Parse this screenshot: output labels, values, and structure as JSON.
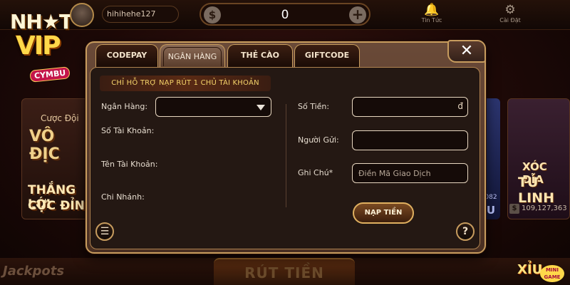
{
  "header": {
    "logo_line1": "NH★T",
    "logo_line2": "VIP",
    "logo_badge": "CYMBU",
    "username": "hihihehe127",
    "currency_symbol": "$",
    "balance": "0",
    "add_symbol": "+",
    "buttons": [
      {
        "icon": "bell-icon",
        "glyph": "🔔",
        "label": "Tin Tức"
      },
      {
        "icon": "gear-icon",
        "glyph": "⚙",
        "label": "Cài Đặt"
      }
    ]
  },
  "background": {
    "left_card": {
      "line1": "Cược Đội",
      "line2": "VÔ ĐỊC",
      "line3": "THẮNG LỚI",
      "line4": "CỰC ĐỈN"
    },
    "mid_strip": {
      "number": "082",
      "text": "U"
    },
    "right_card": {
      "line1": "XÓC ĐĨA",
      "line2": "TỨ LINH"
    },
    "jackpot_currency": "$",
    "jackpot_value": "109,127,363"
  },
  "footer": {
    "jackpots_label": "Jackpots",
    "center_button": "RÚT TIỀN",
    "xiu_label": "XỈU",
    "mini_game_label": "MINI GAME"
  },
  "modal": {
    "tabs": [
      {
        "label": "CODEPAY",
        "active": false
      },
      {
        "label": "NGÂN HÀNG",
        "active": true
      },
      {
        "label": "THẺ CÀO",
        "active": false
      },
      {
        "label": "GIFTCODE",
        "active": false
      }
    ],
    "close_symbol": "✕",
    "notice": "CHỈ HỖ TRỢ NẠP RÚT 1 CHỦ TÀI KHOẢN",
    "left": {
      "bank_label": "Ngân Hàng:",
      "bank_selected": "",
      "account_number_label": "Số Tài Khoản:",
      "account_name_label": "Tên Tài Khoản:",
      "branch_label": "Chi Nhánh:"
    },
    "right": {
      "amount_label": "Số Tiền:",
      "amount_value": "",
      "amount_suffix": "đ",
      "sender_label": "Người Gửi:",
      "sender_value": "",
      "note_label": "Ghi Chú*",
      "note_placeholder": "Điền Mã Giao Dịch"
    },
    "submit_label": "NẠP TIỀN",
    "history_glyph": "☰",
    "help_glyph": "?"
  }
}
